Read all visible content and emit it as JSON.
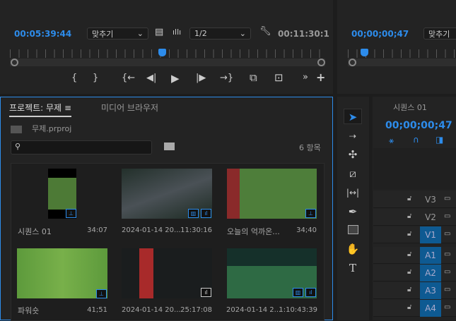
{
  "source_monitor": {
    "timecode": "00:05:39:44",
    "zoom_select": "맞추기",
    "resolution_select": "1/2",
    "duration": "00:11:30:1",
    "playhead_fraction": 0.5
  },
  "program_monitor": {
    "timecode": "00;00;00;47",
    "zoom_select": "맞추기"
  },
  "controls": {
    "mark_in": "{",
    "mark_out": "}",
    "go_in": "{←",
    "step_back": "◀|",
    "play": "▶",
    "step_fwd": "|▶",
    "go_out": "→}",
    "insert": "⧉",
    "overwrite": "⊡",
    "more": "»",
    "add": "+"
  },
  "project": {
    "tab_project": "프로젝트: 무제",
    "tab_menu": "≡",
    "tab_media": "미디어 브라우저",
    "file": "무제.prproj",
    "search_placeholder": "",
    "item_count": "6 항목",
    "items": [
      {
        "name": "시퀀스 01",
        "duration": "34:07"
      },
      {
        "name": "2024-01-14 20...",
        "duration": "11:30:16"
      },
      {
        "name": "오늘의 억까온...",
        "duration": "34;40"
      },
      {
        "name": "파워숏",
        "duration": "41;51"
      },
      {
        "name": "2024-01-14 20...",
        "duration": "25:17:08"
      },
      {
        "name": "2024-01-14 2...",
        "duration": "1:10:43:39"
      }
    ]
  },
  "timeline": {
    "title": "시퀀스 01",
    "timecode": "00;00;00;47",
    "tracks": [
      {
        "name": "V3",
        "on": false
      },
      {
        "name": "V2",
        "on": false
      },
      {
        "name": "V1",
        "on": true
      },
      {
        "name": "A1",
        "on": true
      },
      {
        "name": "A2",
        "on": true
      },
      {
        "name": "A3",
        "on": true
      },
      {
        "name": "A4",
        "on": true
      }
    ]
  },
  "colors": {
    "accent": "#2d8ceb",
    "track_on": "#0e5a92"
  }
}
